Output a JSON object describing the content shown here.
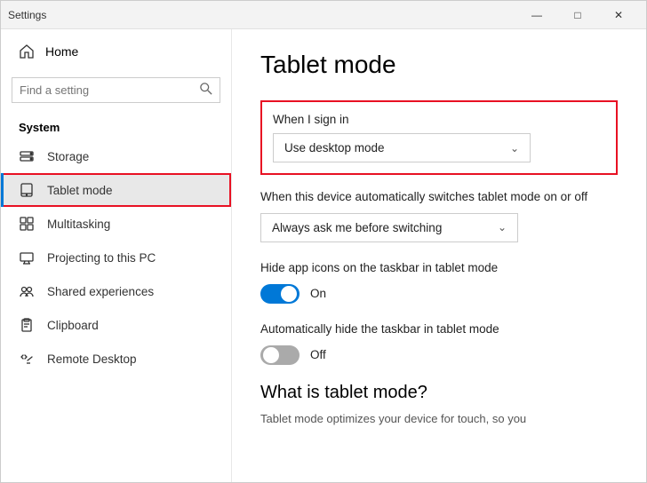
{
  "window": {
    "title": "Settings",
    "controls": {
      "minimize": "—",
      "maximize": "□",
      "close": "✕"
    }
  },
  "sidebar": {
    "home_label": "Home",
    "search_placeholder": "Find a setting",
    "section_title": "System",
    "items": [
      {
        "id": "storage",
        "label": "Storage"
      },
      {
        "id": "tablet-mode",
        "label": "Tablet mode",
        "active": true
      },
      {
        "id": "multitasking",
        "label": "Multitasking"
      },
      {
        "id": "projecting",
        "label": "Projecting to this PC"
      },
      {
        "id": "shared-experiences",
        "label": "Shared experiences"
      },
      {
        "id": "clipboard",
        "label": "Clipboard"
      },
      {
        "id": "remote-desktop",
        "label": "Remote Desktop"
      }
    ]
  },
  "main": {
    "title": "Tablet mode",
    "when_sign_in_label": "When I sign in",
    "sign_in_dropdown": "Use desktop mode",
    "auto_switch_label": "When this device automatically switches tablet mode on or off",
    "auto_switch_dropdown": "Always ask me before switching",
    "hide_icons_label": "Hide app icons on the taskbar in tablet mode",
    "hide_icons_toggle": "On",
    "hide_icons_state": "on",
    "auto_hide_label": "Automatically hide the taskbar in tablet mode",
    "auto_hide_toggle": "Off",
    "auto_hide_state": "off",
    "what_title": "What is tablet mode?",
    "what_desc": "Tablet mode optimizes your device for touch, so you"
  }
}
